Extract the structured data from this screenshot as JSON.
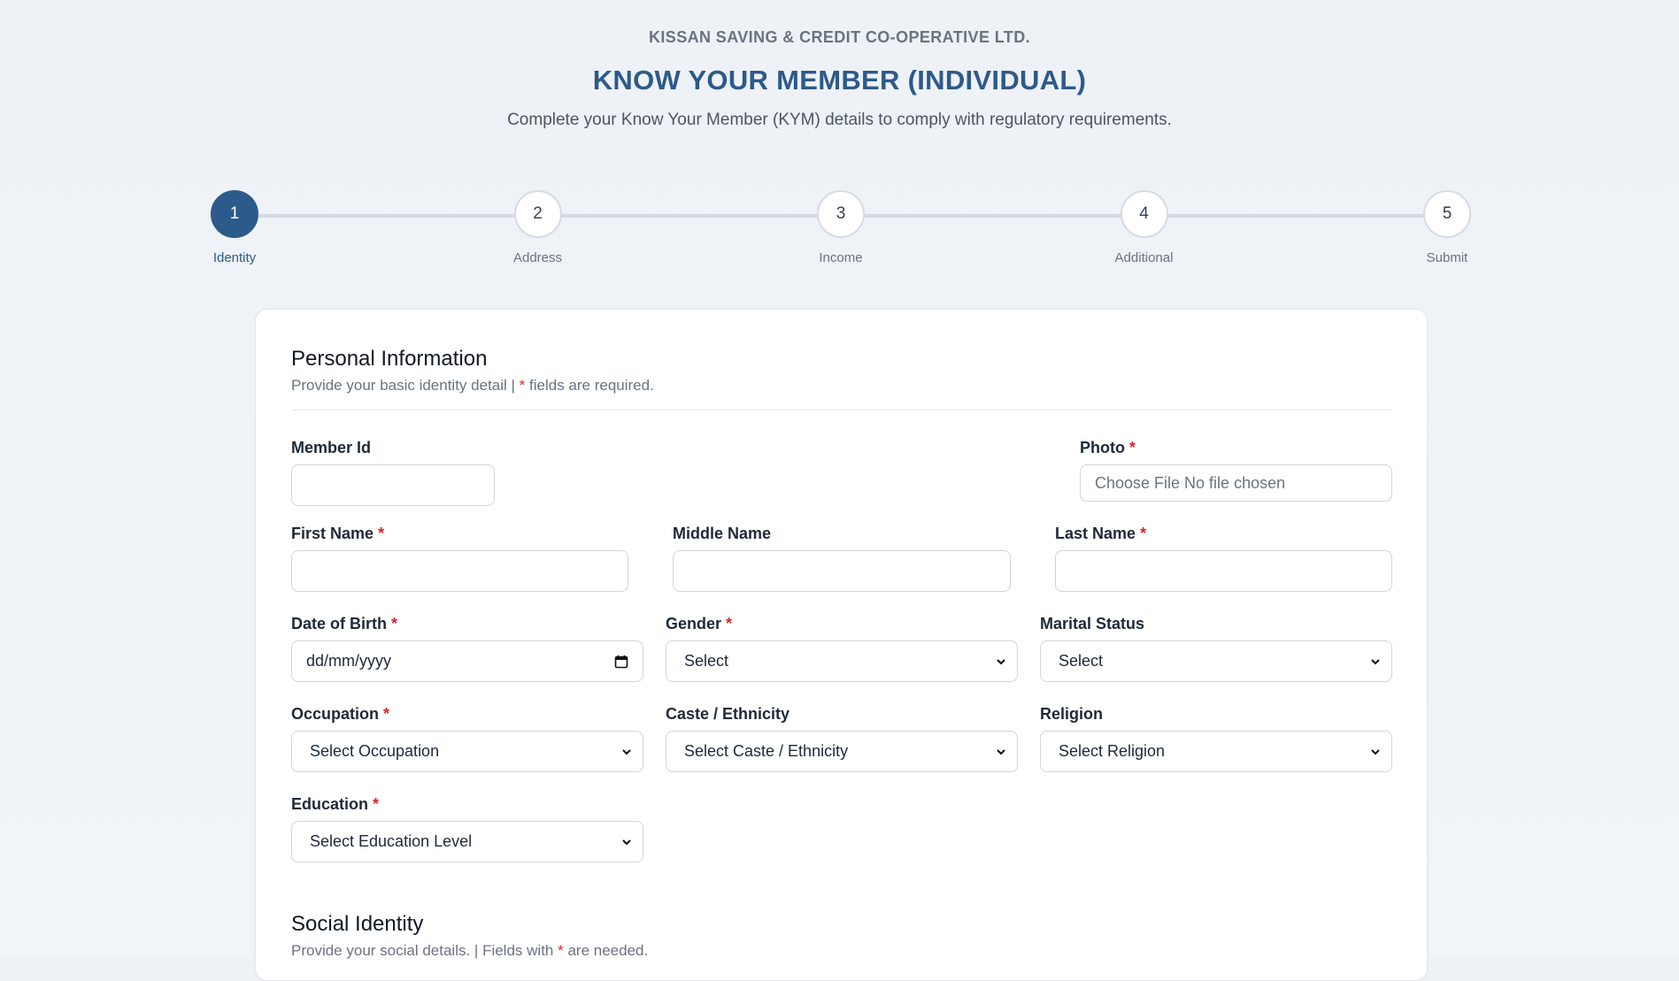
{
  "header": {
    "org_name": "KISSAN SAVING & CREDIT CO-OPERATIVE LTD.",
    "title": "KNOW YOUR MEMBER (INDIVIDUAL)",
    "subtitle": "Complete your Know Your Member (KYM) details to comply with regulatory requirements."
  },
  "stepper": {
    "active_step": 1,
    "steps": [
      {
        "number": "1",
        "label": "Identity"
      },
      {
        "number": "2",
        "label": "Address"
      },
      {
        "number": "3",
        "label": "Income"
      },
      {
        "number": "4",
        "label": "Additional"
      },
      {
        "number": "5",
        "label": "Submit"
      }
    ]
  },
  "colors": {
    "accent": "#2c5a8a",
    "required": "#dc2626"
  },
  "personal": {
    "title": "Personal Information",
    "desc_prefix": "Provide your basic identity detail | ",
    "desc_star": "*",
    "desc_suffix": " fields are required.",
    "fields": {
      "member_id": {
        "label": "Member Id",
        "value": ""
      },
      "photo": {
        "label": "Photo",
        "value": "Choose File No file chosen"
      },
      "first_name": {
        "label": "First Name",
        "value": ""
      },
      "middle_name": {
        "label": "Middle Name",
        "value": ""
      },
      "last_name": {
        "label": "Last Name",
        "value": ""
      },
      "dob": {
        "label": "Date of Birth",
        "value": "dd/mm/yyyy"
      },
      "gender": {
        "label": "Gender",
        "value": "Select"
      },
      "marital_status": {
        "label": "Marital Status",
        "value": "Select"
      },
      "occupation": {
        "label": "Occupation",
        "value": "Select Occupation"
      },
      "caste": {
        "label": "Caste / Ethnicity",
        "value": "Select Caste / Ethnicity"
      },
      "religion": {
        "label": "Religion",
        "value": "Select Religion"
      },
      "education": {
        "label": "Education",
        "value": "Select Education Level"
      }
    },
    "required_marker": "*"
  },
  "social": {
    "title": "Social Identity",
    "desc_prefix": "Provide your social details. | Fields with ",
    "desc_star": "*",
    "desc_suffix": " are needed."
  }
}
